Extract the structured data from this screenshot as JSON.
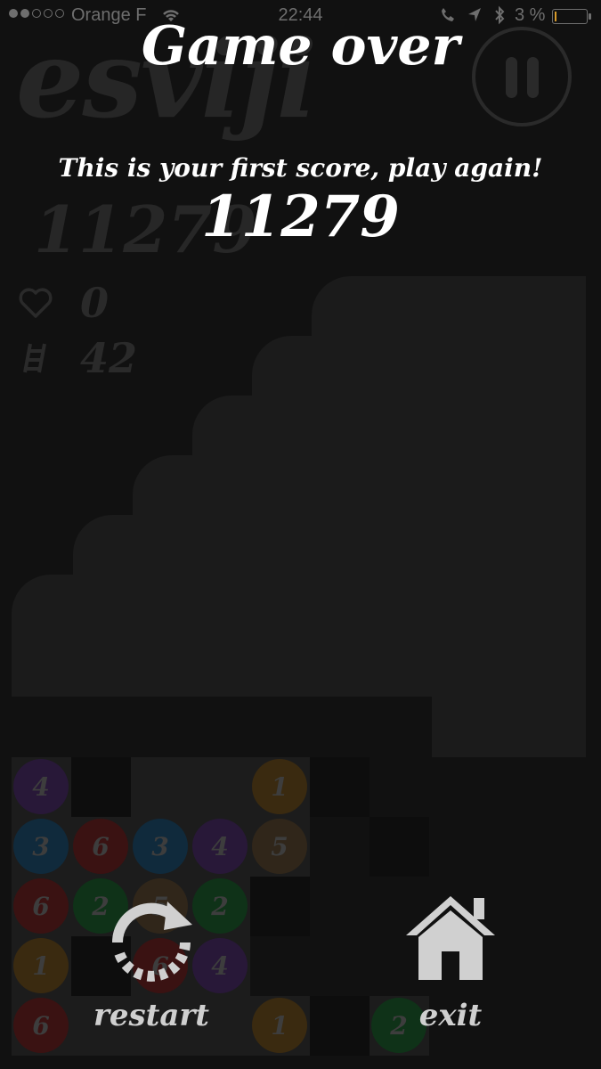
{
  "status_bar": {
    "carrier": "Orange F",
    "time": "22:44",
    "battery": "3 %"
  },
  "game": {
    "logo": "esviji",
    "score": "11279",
    "lives": "0",
    "level": "42",
    "grid": [
      [
        "4",
        "",
        "",
        "",
        "1",
        "",
        ""
      ],
      [
        "3",
        "6",
        "3",
        "4",
        "5",
        "",
        ""
      ],
      [
        "6",
        "2",
        "5",
        "2",
        "",
        "",
        ""
      ],
      [
        "1",
        "",
        "6",
        "4",
        "",
        "",
        ""
      ],
      [
        "6",
        "",
        "",
        "",
        "1",
        "",
        "2"
      ]
    ],
    "colors": {
      "1": "#3a2a10",
      "2": "#0f3218",
      "3": "#102a3c",
      "4": "#281838",
      "5": "#30261a",
      "6": "#3a1212"
    }
  },
  "overlay": {
    "title": "Game over",
    "message": "This is your first score, play again!",
    "score": "11279",
    "restart_label": "restart",
    "exit_label": "exit"
  }
}
